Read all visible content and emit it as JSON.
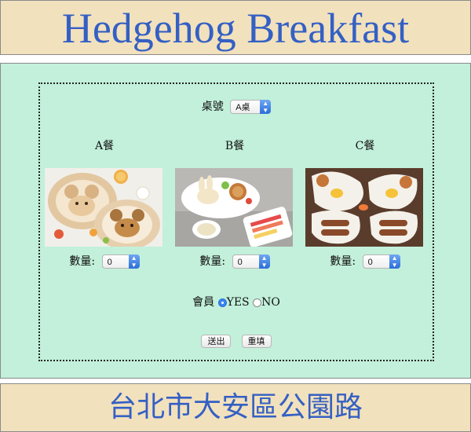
{
  "header": {
    "title": "Hedgehog Breakfast"
  },
  "form": {
    "table_label": "桌號",
    "table_select": {
      "value": "A桌"
    },
    "meals": [
      {
        "title": "A餐",
        "qty_label": "數量:",
        "qty_value": "0",
        "image": "hedgehog-bear-pancake-plate"
      },
      {
        "title": "B餐",
        "qty_label": "數量:",
        "qty_value": "0",
        "image": "rabbit-pancake-breakfast-plate"
      },
      {
        "title": "C餐",
        "qty_label": "數量:",
        "qty_value": "0",
        "image": "sausage-egg-breakfast-plates"
      }
    ],
    "member_label": "會員",
    "member_options": [
      {
        "label": "YES",
        "checked": true
      },
      {
        "label": "NO",
        "checked": false
      }
    ],
    "submit_label": "送出",
    "reset_label": "重填"
  },
  "footer": {
    "address": "台北市大安區公園路"
  },
  "colors": {
    "title": "#3460c4",
    "header_bg": "#f2e1bd",
    "main_bg": "#c2f0da",
    "select_arrow": "#2b6ed9"
  }
}
